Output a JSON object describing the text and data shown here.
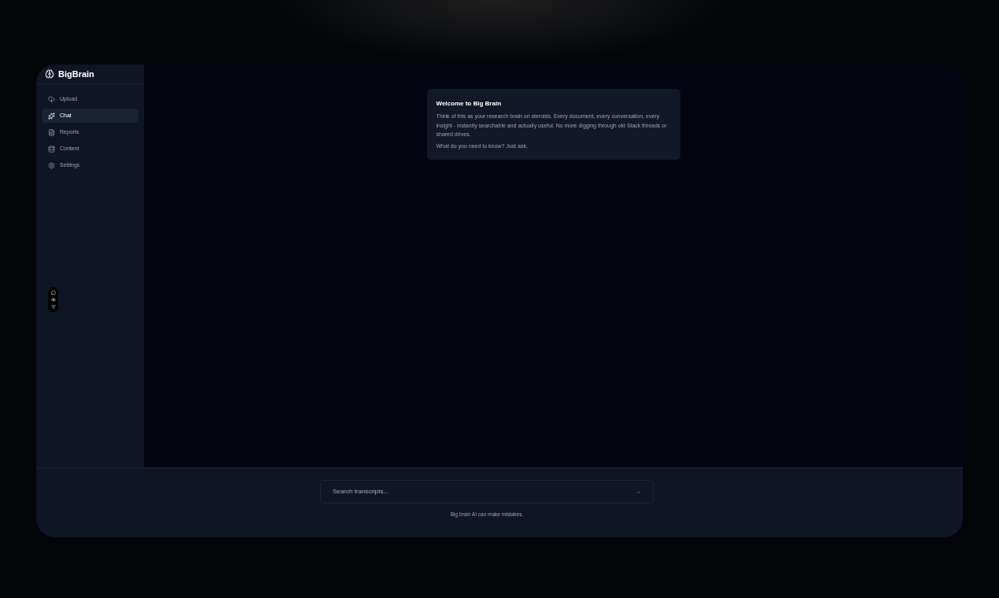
{
  "sidebar": {
    "logo": "BigBrain",
    "items": [
      {
        "label": "Upload",
        "selected": false
      },
      {
        "label": "Chat",
        "selected": true
      },
      {
        "label": "Reports",
        "selected": false
      },
      {
        "label": "Content",
        "selected": false
      },
      {
        "label": "Settings",
        "selected": false
      }
    ]
  },
  "welcome": {
    "title": "Welcome to Big Brain",
    "body": "Think of this as your research brain on steroids. Every document, every conversation, every insight - instantly searchable and actually useful. No more digging through old Slack threads or shared drives.",
    "prompt": "What do you need to know? Just ask."
  },
  "search": {
    "placeholder": "Search transcripts...",
    "button": "→"
  },
  "disclaimer": "Big brain AI can make mistakes."
}
